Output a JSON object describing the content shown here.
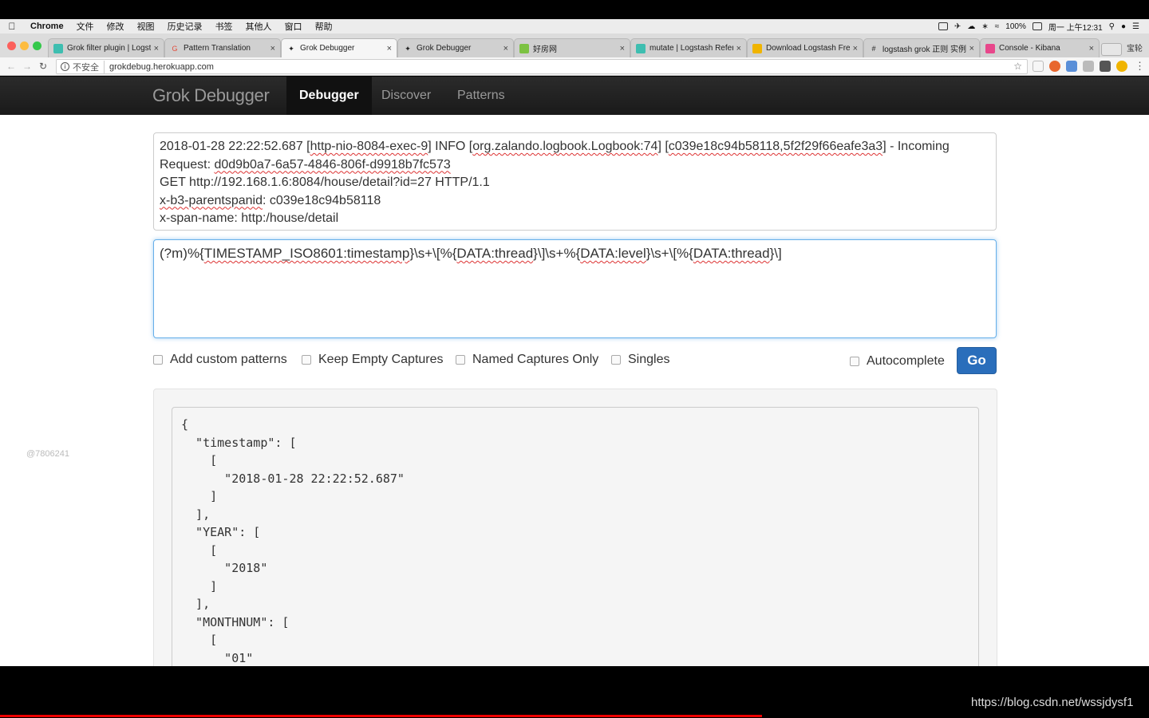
{
  "menubar": {
    "apple": "",
    "items": [
      "Chrome",
      "文件",
      "修改",
      "视图",
      "历史记录",
      "书签",
      "其他人",
      "窗口",
      "帮助"
    ],
    "battery": "100%",
    "clock": "周一 上午12:31"
  },
  "tabs": [
    {
      "title": "Grok filter plugin | Logst",
      "favicon_color": "#3ebeb0"
    },
    {
      "title": "Pattern Translation",
      "favicon_color": "#e24b3b"
    },
    {
      "title": "Grok Debugger",
      "favicon_color": "#666666"
    },
    {
      "title": "Grok Debugger",
      "favicon_color": "#666666"
    },
    {
      "title": "好房网",
      "favicon_color": "#7cc242"
    },
    {
      "title": "mutate | Logstash Refere",
      "favicon_color": "#3ebeb0"
    },
    {
      "title": "Download Logstash Free",
      "favicon_color": "#f0b400"
    },
    {
      "title": "logstash grok 正则 实例",
      "favicon_color": "#555555"
    },
    {
      "title": "Console - Kibana",
      "favicon_color": "#e8478b"
    }
  ],
  "profile": "宝轮",
  "toolbar": {
    "insecure": "不安全",
    "url": "grokdebug.herokuapp.com"
  },
  "nav": {
    "brand": "Grok Debugger",
    "links": [
      "Debugger",
      "Discover",
      "Patterns"
    ]
  },
  "log_input": {
    "line1_date": "2018-01-28 22:22:52.687 [",
    "line1_thread": "http-nio-8084-exec-9",
    "line1_mid": "] INFO  [",
    "line1_logger": "org.zalando.logbook.Logbook:74",
    "line1_mid2": "] [",
    "line1_trace": "c039e18c94b58118,5f2f29f66eafe3a3",
    "line1_end": "] - Incoming",
    "line2_pre": "Request: ",
    "line2_id": "d0d9b0a7-6a57-4846-806f-d9918b7fc573",
    "line3": "GET http://192.168.1.6:8084/house/detail?id=27 HTTP/1.1",
    "line4_key": "x-b3-parentspanid",
    "line4_val": ": c039e18c94b58118",
    "line5": "x-span-name: http:/house/detail"
  },
  "pattern_input": {
    "p1": "(?m)%{",
    "p2": "TIMESTAMP_ISO8601:timestamp",
    "p3": "}\\s+\\[%{",
    "p4": "DATA:thread",
    "p5": "}\\]\\s+%{",
    "p6": "DATA:level",
    "p7": "}\\s+\\[%{",
    "p8": "DATA:thread",
    "p9": "}\\]"
  },
  "options": {
    "custom_patterns": "Add custom patterns",
    "keep_empty": "Keep Empty Captures",
    "named_only": "Named Captures Only",
    "singles": "Singles",
    "autocomplete": "Autocomplete",
    "go": "Go"
  },
  "result_text": "{\n  \"timestamp\": [\n    [\n      \"2018-01-28 22:22:52.687\"\n    ]\n  ],\n  \"YEAR\": [\n    [\n      \"2018\"\n    ]\n  ],\n  \"MONTHNUM\": [\n    [\n      \"01\"",
  "watermark": "@7806241",
  "csdn_url": "https://blog.csdn.net/wssjdysf1"
}
